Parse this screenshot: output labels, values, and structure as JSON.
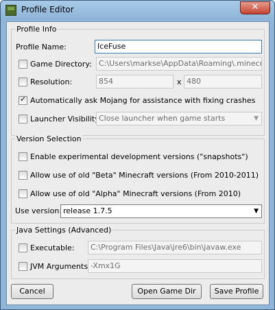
{
  "window": {
    "title": "Profile Editor",
    "close_symbol": "✕"
  },
  "profile_info": {
    "title": "Profile Info",
    "profile_name_label": "Profile Name:",
    "profile_name_value": "IceFuse",
    "game_directory_label": "Game Directory:",
    "game_directory_value": "C:\\Users\\markse\\AppData\\Roaming\\.minecraft",
    "game_directory_checked": false,
    "resolution_label": "Resolution:",
    "resolution_width": "854",
    "resolution_x": "x",
    "resolution_height": "480",
    "resolution_checked": false,
    "auto_ask_label": "Automatically ask Mojang for assistance with fixing crashes",
    "auto_ask_checked": true,
    "launcher_visibility_label": "Launcher Visibility:",
    "launcher_visibility_value": "Close launcher when game starts",
    "launcher_visibility_checked": false
  },
  "version_selection": {
    "title": "Version Selection",
    "snapshots_label": "Enable experimental development versions (\"snapshots\")",
    "beta_label": "Allow use of old \"Beta\" Minecraft versions (From 2010-2011)",
    "alpha_label": "Allow use of old \"Alpha\" Minecraft versions (From 2010)",
    "use_version_label": "Use version:",
    "use_version_value": "release 1.7.5"
  },
  "java_settings": {
    "title": "Java Settings (Advanced)",
    "executable_label": "Executable:",
    "executable_value": "C:\\Program Files\\Java\\jre6\\bin\\javaw.exe",
    "jvm_label": "JVM Arguments:",
    "jvm_value": "-Xmx1G"
  },
  "buttons": {
    "cancel": "Cancel",
    "open_game_dir": "Open Game Dir",
    "save_profile": "Save Profile"
  },
  "icons": {
    "app": "minecraft-grass-block-icon",
    "close": "close-icon",
    "dropdown": "dropdown-arrow-icon",
    "check": "checkmark-icon"
  }
}
